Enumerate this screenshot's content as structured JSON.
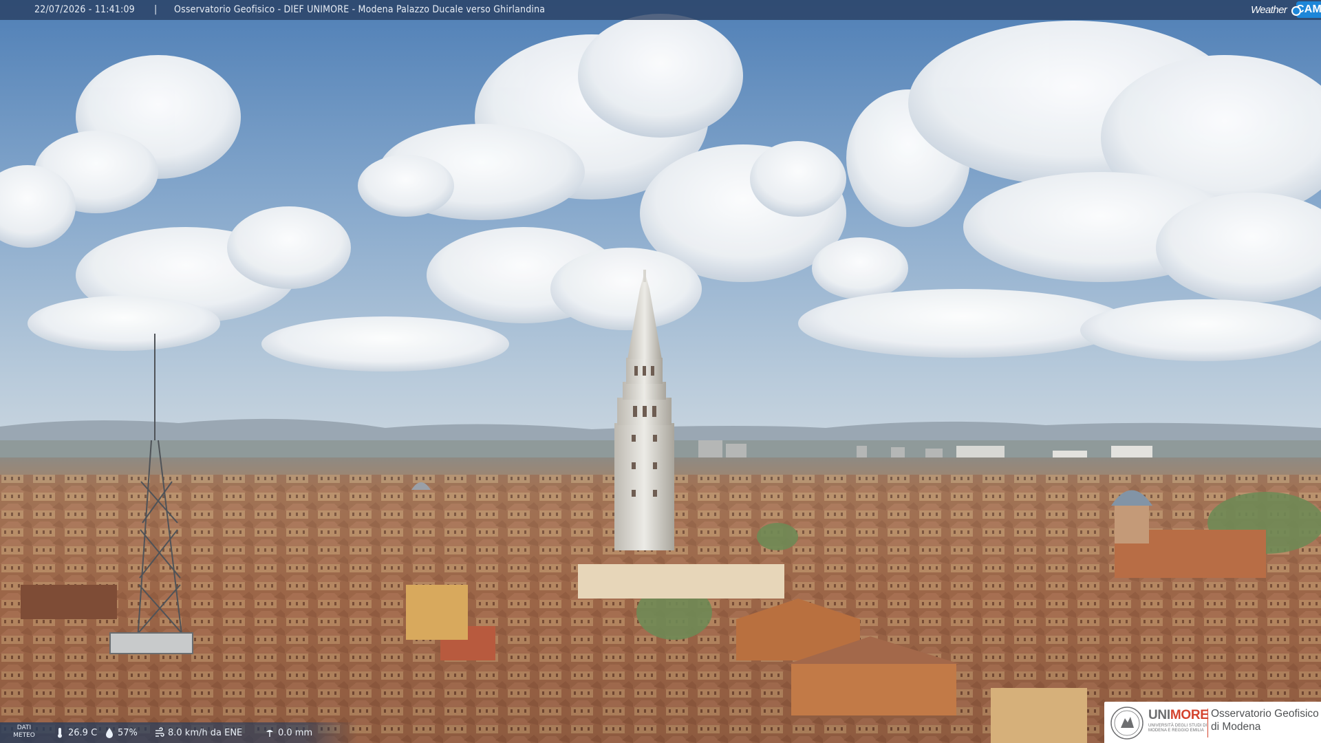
{
  "header": {
    "timestamp": "22/07/2026 - 11:41:09",
    "separator": "|",
    "title": "Osservatorio Geofisico - DIEF UNIMORE - Modena Palazzo Ducale verso Ghirlandina",
    "brand_weather": "Weather",
    "brand_cam": "CAM"
  },
  "meteo": {
    "label": "DATI\nMETEO",
    "temperature": "26.9 C",
    "humidity": "57%",
    "wind": "8.0 km/h da ENE",
    "rain": "0.0 mm",
    "icons": [
      "thermometer-icon",
      "humidity-drop-icon",
      "wind-icon",
      "rain-icon"
    ]
  },
  "logo": {
    "uni_part1": "UNI",
    "uni_part2": "MORE",
    "uni_sub": "UNIVERSITÀ DEGLI STUDI DI MODENA E REGGIO EMILIA",
    "observatory_line1": "Osservatorio Geofisico",
    "observatory_line2": "di Modena"
  },
  "colors": {
    "sky_top": "#5f8bbd",
    "sky_horizon": "#c4d3df",
    "roofs": "#a8704f",
    "overlay_bar": "#283e60",
    "brand_blue": "#1d86d8",
    "unimore_red": "#d4442e"
  }
}
